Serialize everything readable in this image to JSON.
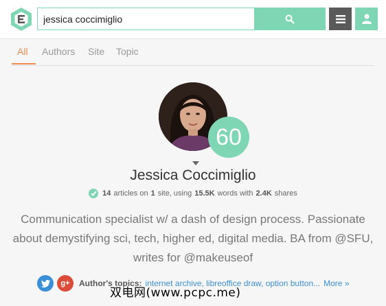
{
  "search": {
    "query": "jessica coccimiglio"
  },
  "tabs": [
    {
      "label": "All",
      "active": true
    },
    {
      "label": "Authors"
    },
    {
      "label": "Site"
    },
    {
      "label": "Topic"
    }
  ],
  "profile": {
    "score": "60",
    "name": "Jessica Coccimiglio",
    "stats": {
      "articles": "14",
      "articles_label": "articles on",
      "sites": "1",
      "sites_label": "site, using",
      "words": "15.5K",
      "words_label": "words with",
      "shares": "2.4K",
      "shares_label": "shares"
    },
    "bio": "Communication specialist w/ a dash of design process. Passionate about demystifying sci, tech, higher ed, digital media. BA from @SFU, writes for @makeuseof",
    "topics_label": "Author's topics:",
    "topics": "internet archive, libreoffice draw, option button...",
    "more_link": "More »"
  },
  "watermark": "双电网(www.pcpc.me)",
  "colors": {
    "accent": "#7fd6b5",
    "active_tab": "#f08a4b",
    "link": "#3a8fd6",
    "twitter": "#3a8fd6",
    "gplus": "#dc4a38"
  }
}
